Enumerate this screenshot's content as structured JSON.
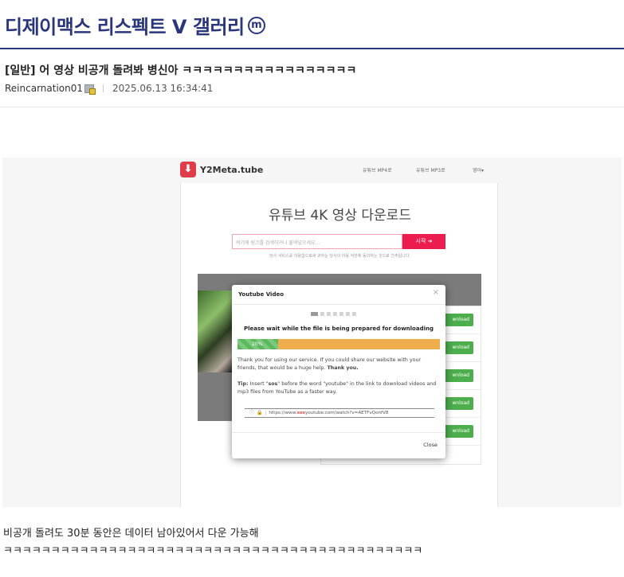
{
  "gallery": {
    "title": "디제이맥스 리스펙트 V 갤러리",
    "badge": "m"
  },
  "post": {
    "title": "[일반] 어 영상 비공개 돌려봐 병신아 ㅋㅋㅋㅋㅋㅋㅋㅋㅋㅋㅋㅋㅋㅋㅋㅋㅋ",
    "author": "Reincarnation01",
    "datetime": "2025.06.13 16:34:41",
    "body_lines": [
      "비공개 돌려도 30분 동안은 데이터 남아있어서 다운 가능해",
      "ㅋㅋㅋㅋㅋㅋㅋㅋㅋㅋㅋㅋㅋㅋㅋㅋㅋㅋㅋㅋㅋㅋㅋㅋㅋㅋㅋㅋㅋㅋㅋㅋㅋㅋㅋㅋㅋㅋㅋㅋㅋㅋㅋㅋ"
    ]
  },
  "screenshot": {
    "site_name": "Y2Meta.tube",
    "logo_icon": "download-arrow",
    "nav": [
      "유튜브 MP4로",
      "유튜브 MP3로",
      "영어▾"
    ],
    "heading": "유튜브 4K 영상 다운로드",
    "input_placeholder": "여기에 링크를 검색하거나 붙여넣으세요...",
    "start_button": "시작 ➜",
    "terms": "당사 서비스를 이용함으로써 귀하는 당사의 이용 약관에 동의하는 것으로 간주됩니다.",
    "download_label": "wnload",
    "modal": {
      "title": "Youtube Video",
      "wait": "Please wait while the file is being prepared for downloading",
      "progress": 0.2,
      "progress_text": "20%",
      "thanks": "Thank you for using our service. If you could share our website with your friends, that would be a huge help.",
      "thanks_bold": "Thank you.",
      "tip_label": "Tip:",
      "tip_a": "Insert \"",
      "tip_sos": "sos",
      "tip_b": "\" before the word \"youtube\" in the link to download videos and mp3 files from YouTube as a faster way.",
      "url_prefix": "https://www.",
      "url_sos": "sos",
      "url_rest": "youtube.com/watch?v=AETFvQonfV8",
      "close": "Close"
    },
    "colors": {
      "accent": "#ec1c4e",
      "progress_done": "#5cb85c",
      "progress_rest": "#f0ad4e",
      "download": "#4cae4c"
    }
  }
}
